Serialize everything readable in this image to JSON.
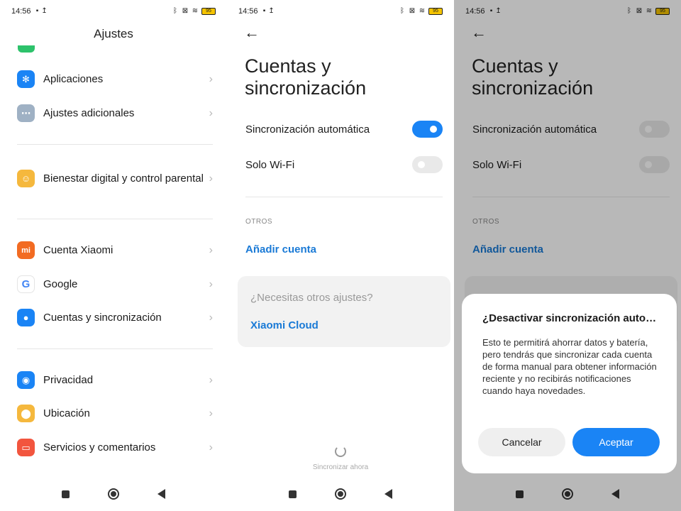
{
  "status": {
    "time": "14:56",
    "battery": "95"
  },
  "settings": {
    "title": "Ajustes",
    "items": [
      {
        "label": "Aplicaciones",
        "icon": "gear-icon",
        "color": "#1a84f5"
      },
      {
        "label": "Ajustes adicionales",
        "icon": "more-icon",
        "color": "#8aa0b8"
      },
      {
        "label": "Bienestar digital y control parental",
        "icon": "wellbeing-icon",
        "color": "#f5b83d"
      },
      {
        "label": "Cuenta Xiaomi",
        "icon": "mi-logo-icon",
        "color": "#f26b22"
      },
      {
        "label": "Google",
        "icon": "google-logo-icon",
        "color": "#ffffff"
      },
      {
        "label": "Cuentas y sincronización",
        "icon": "user-icon",
        "color": "#1a84f5"
      },
      {
        "label": "Privacidad",
        "icon": "eye-icon",
        "color": "#1a84f5"
      },
      {
        "label": "Ubicación",
        "icon": "location-icon",
        "color": "#f5b83d"
      },
      {
        "label": "Servicios y comentarios",
        "icon": "feedback-icon",
        "color": "#f2553e"
      }
    ]
  },
  "accounts": {
    "title_line1": "Cuentas y",
    "title_line2": "sincronización",
    "auto_sync_label": "Sincronización automática",
    "wifi_only_label": "Solo Wi-Fi",
    "section_others": "OTROS",
    "add_account": "Añadir cuenta",
    "more_settings_question": "¿Necesitas otros ajustes?",
    "xiaomi_cloud": "Xiaomi Cloud",
    "sync_now": "Sincronizar ahora",
    "auto_sync_on": true,
    "wifi_only_on": false
  },
  "dialog": {
    "title": "¿Desactivar sincronización autom…",
    "body": "Esto te permitirá ahorrar datos y batería, pero tendrás que sincronizar cada cuenta de forma manual para obtener información reciente y no recibirás notificaciones cuando haya novedades.",
    "cancel": "Cancelar",
    "accept": "Aceptar"
  },
  "colors": {
    "accent": "#1a84f5",
    "link": "#1a7ad6"
  }
}
